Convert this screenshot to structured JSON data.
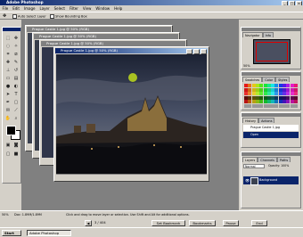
{
  "app": {
    "title": "Adobe Photoshop",
    "controls": [
      "_",
      "□",
      "×"
    ]
  },
  "menu": [
    "File",
    "Edit",
    "Image",
    "Layer",
    "Select",
    "Filter",
    "View",
    "Window",
    "Help"
  ],
  "options": {
    "auto_select": "Auto Select Layer",
    "bounding": "Show Bounding Box"
  },
  "documents": [
    {
      "title": "Prague Castle 1.jpg @ 50% (RGB)"
    },
    {
      "title": "Prague Castle 1.jpg @ 50% (RGB)"
    },
    {
      "title": "Prague Castle 1.jpg @ 50% (RGB)"
    },
    {
      "title": "Prague Castle 1.jpg @ 50% (RGB)"
    }
  ],
  "panels": {
    "navigator": {
      "tabs": [
        "Navigator",
        "Info"
      ],
      "zoom": "50%"
    },
    "color": {
      "tabs": [
        "Swatches",
        "Color",
        "Styles"
      ]
    },
    "history": {
      "tabs": [
        "History",
        "Actions"
      ],
      "items": [
        "Prague Castle 1.jpg",
        "Open"
      ]
    },
    "layers": {
      "tabs": [
        "Layers",
        "Channels",
        "Paths"
      ],
      "mode": "Normal",
      "opacity": "Opacity: 100%",
      "layer": "Background"
    }
  },
  "status": {
    "zoom": "50%",
    "doc": "Doc: 1.89M/1.89M",
    "hint": "Click and drag to move layer or selection. Use Shift and Alt for additional options."
  },
  "playbar": {
    "counter": "3 / 404",
    "buttons": [
      "Set Bookmark",
      "Bookmarks",
      "Pause",
      "End"
    ]
  },
  "taskbar": {
    "start": "Start",
    "app": "Adobe Photoshop"
  },
  "colors": {
    "title_dark": "#0a246a",
    "title_light": "#a6caf0",
    "workspace": "#808080",
    "chrome": "#d4d0c8"
  }
}
